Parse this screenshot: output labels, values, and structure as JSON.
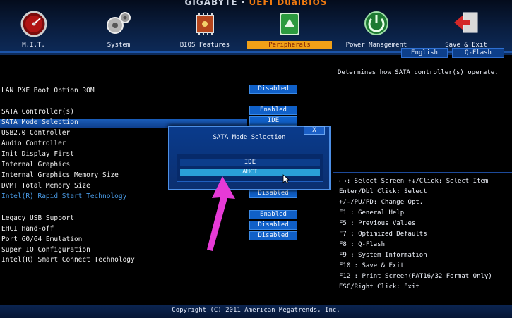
{
  "brand": {
    "left": "GIGABYTE",
    "sep": " · ",
    "right": "UEFI DualBIOS"
  },
  "tabs": [
    {
      "label": "M.I.T."
    },
    {
      "label": "System"
    },
    {
      "label": "BIOS Features"
    },
    {
      "label": "Peripherals"
    },
    {
      "label": "Power Management"
    },
    {
      "label": "Save & Exit"
    }
  ],
  "buttons": {
    "english": "English",
    "qflash": "Q-Flash"
  },
  "settings": [
    {
      "label": "LAN PXE Boot Option ROM",
      "value": "Disabled"
    },
    {
      "label": "SATA Controller(s)",
      "value": "Enabled"
    },
    {
      "label": "SATA Mode Selection",
      "value": "IDE"
    },
    {
      "label": "USB2.0 Controller",
      "value": ""
    },
    {
      "label": "Audio Controller",
      "value": ""
    },
    {
      "label": "Init Display First",
      "value": ""
    },
    {
      "label": "Internal Graphics",
      "value": ""
    },
    {
      "label": "Internal Graphics Memory Size",
      "value": ""
    },
    {
      "label": "DVMT Total Memory Size",
      "value": ""
    },
    {
      "label": "Intel(R) Rapid Start Technology",
      "value": "Disabled"
    },
    {
      "label": "Legacy USB Support",
      "value": "Enabled"
    },
    {
      "label": "EHCI Hand-off",
      "value": "Disabled"
    },
    {
      "label": "Port 60/64 Emulation",
      "value": "Disabled"
    },
    {
      "label": "Super IO Configuration",
      "value": ""
    },
    {
      "label": "Intel(R) Smart Connect Technology",
      "value": ""
    }
  ],
  "help": {
    "description": "Determines how SATA controller(s) operate.",
    "keys": [
      "←→: Select Screen  ↑↓/Click: Select Item",
      "Enter/Dbl Click: Select",
      "+/-/PU/PD: Change Opt.",
      "F1  : General Help",
      "F5  : Previous Values",
      "F7  : Optimized Defaults",
      "F8  : Q-Flash",
      "F9  : System Information",
      "F10 : Save & Exit",
      "F12 : Print Screen(FAT16/32 Format Only)",
      "ESC/Right Click: Exit"
    ]
  },
  "modal": {
    "title": "SATA Mode Selection",
    "close": "X",
    "options": [
      "IDE",
      "AHCI"
    ],
    "highlighted": "AHCI"
  },
  "footer": "Copyright (C) 2011 American Megatrends, Inc.",
  "colors": {
    "accent": "#f0a018",
    "value_bg": "#1060c8",
    "highlight": "#2a9fd8",
    "arrow": "#e63ad6"
  }
}
